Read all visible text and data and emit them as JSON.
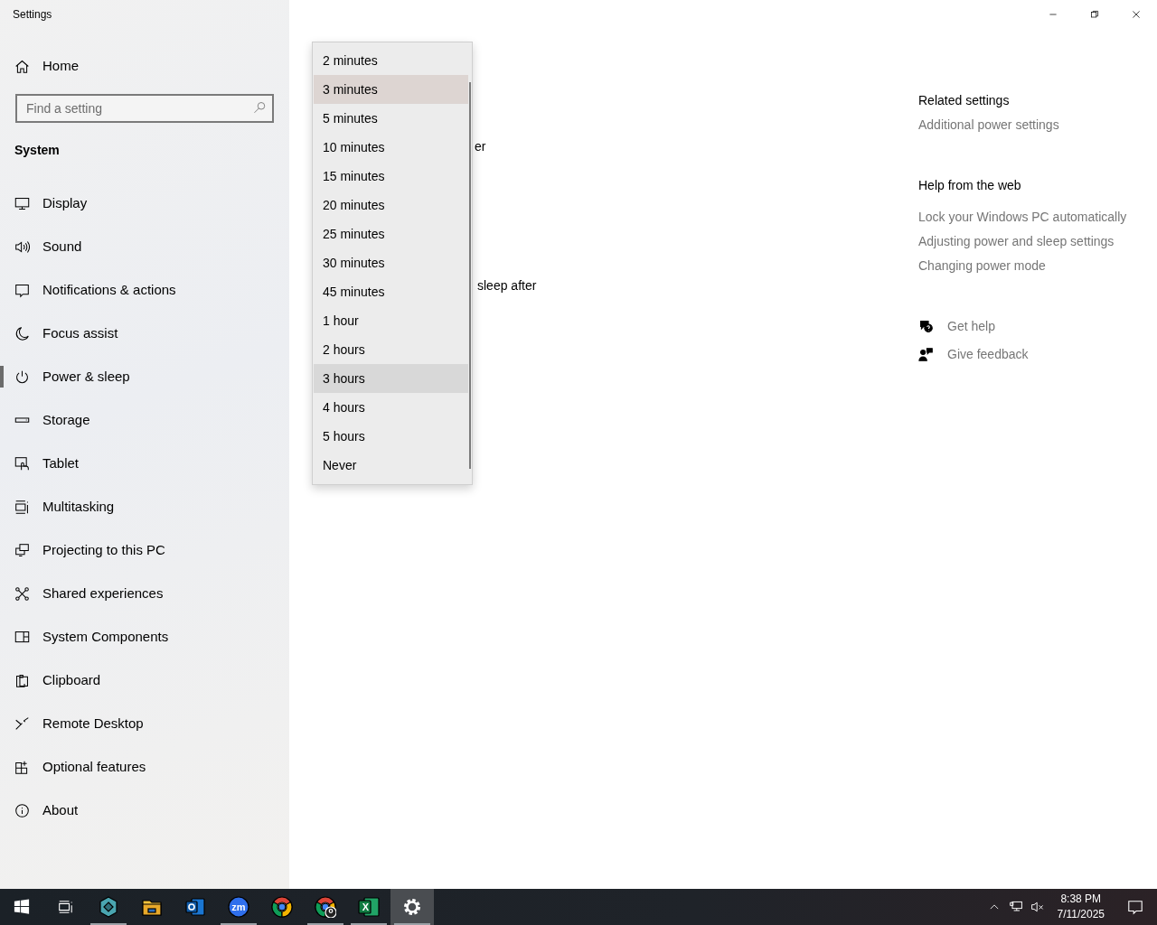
{
  "window": {
    "title": "Settings"
  },
  "sidebar": {
    "home": "Home",
    "search": {
      "placeholder": "Find a setting"
    },
    "section": "System",
    "items": [
      {
        "label": "Display",
        "selected": false
      },
      {
        "label": "Sound",
        "selected": false
      },
      {
        "label": "Notifications & actions",
        "selected": false
      },
      {
        "label": "Focus assist",
        "selected": false
      },
      {
        "label": "Power & sleep",
        "selected": true
      },
      {
        "label": "Storage",
        "selected": false
      },
      {
        "label": "Tablet",
        "selected": false
      },
      {
        "label": "Multitasking",
        "selected": false
      },
      {
        "label": "Projecting to this PC",
        "selected": false
      },
      {
        "label": "Shared experiences",
        "selected": false
      },
      {
        "label": "System Components",
        "selected": false
      },
      {
        "label": "Clipboard",
        "selected": false
      },
      {
        "label": "Remote Desktop",
        "selected": false
      },
      {
        "label": "Optional features",
        "selected": false
      },
      {
        "label": "About",
        "selected": false
      }
    ]
  },
  "main": {
    "partial_texts": [
      "er",
      "sleep after"
    ]
  },
  "dropdown": {
    "options": [
      {
        "label": "2 minutes",
        "selected": false,
        "hovered": false
      },
      {
        "label": "3 minutes",
        "selected": true,
        "hovered": false
      },
      {
        "label": "5 minutes",
        "selected": false,
        "hovered": false
      },
      {
        "label": "10 minutes",
        "selected": false,
        "hovered": false
      },
      {
        "label": "15 minutes",
        "selected": false,
        "hovered": false
      },
      {
        "label": "20 minutes",
        "selected": false,
        "hovered": false
      },
      {
        "label": "25 minutes",
        "selected": false,
        "hovered": false
      },
      {
        "label": "30 minutes",
        "selected": false,
        "hovered": false
      },
      {
        "label": "45 minutes",
        "selected": false,
        "hovered": false
      },
      {
        "label": "1 hour",
        "selected": false,
        "hovered": false
      },
      {
        "label": "2 hours",
        "selected": false,
        "hovered": false
      },
      {
        "label": "3 hours",
        "selected": false,
        "hovered": true
      },
      {
        "label": "4 hours",
        "selected": false,
        "hovered": false
      },
      {
        "label": "5 hours",
        "selected": false,
        "hovered": false
      },
      {
        "label": "Never",
        "selected": false,
        "hovered": false
      }
    ]
  },
  "related_settings": {
    "heading": "Related settings",
    "links": [
      "Additional power settings"
    ]
  },
  "help_from_web": {
    "heading": "Help from the web",
    "links": [
      "Lock your Windows PC automatically",
      "Adjusting power and sleep settings",
      "Changing power mode"
    ]
  },
  "support_links": [
    "Get help",
    "Give feedback"
  ],
  "taskbar": {
    "apps": [
      {
        "running": true,
        "active": false
      },
      {
        "running": false,
        "active": false
      },
      {
        "running": false,
        "active": false
      },
      {
        "label": "zm",
        "running": true,
        "active": false
      },
      {
        "running": false,
        "active": false
      },
      {
        "running": true,
        "active": false
      },
      {
        "label": "X",
        "running": true,
        "active": false
      },
      {
        "running": true,
        "active": true
      }
    ],
    "time": "8:38 PM",
    "date": "7/11/2025"
  }
}
